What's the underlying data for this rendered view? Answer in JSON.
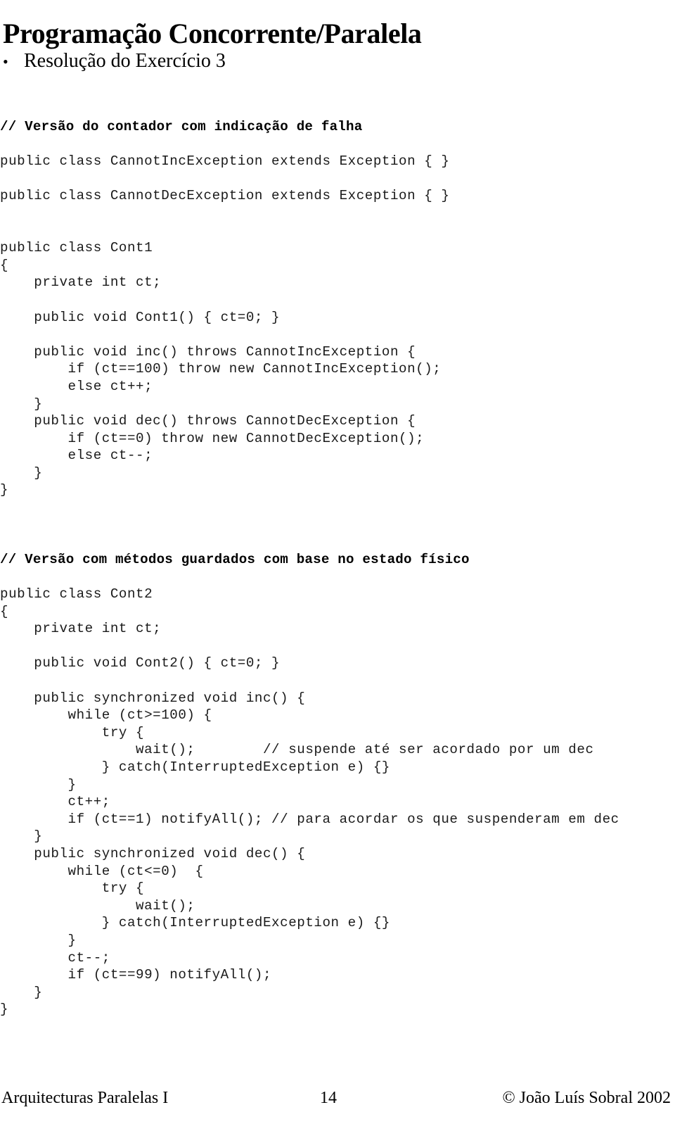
{
  "slide": {
    "title": "Programação Concorrente/Paralela",
    "bullet_marker": "•",
    "bullet_text": "Resolução do Exercício 3"
  },
  "code": {
    "lines": [
      {
        "text": "// Versão do contador com indicação de falha",
        "style": "comment-head"
      },
      {
        "text": "",
        "style": "blank"
      },
      {
        "text": "public class CannotIncException extends Exception { }",
        "style": "code"
      },
      {
        "text": "",
        "style": "blank"
      },
      {
        "text": "public class CannotDecException extends Exception { }",
        "style": "code"
      },
      {
        "text": "",
        "style": "blank"
      },
      {
        "text": "",
        "style": "blank"
      },
      {
        "text": "public class Cont1",
        "style": "code"
      },
      {
        "text": "{",
        "style": "code"
      },
      {
        "text": "    private int ct;",
        "style": "code"
      },
      {
        "text": "",
        "style": "blank"
      },
      {
        "text": "    public void Cont1() { ct=0; }",
        "style": "code"
      },
      {
        "text": "",
        "style": "blank"
      },
      {
        "text": "    public void inc() throws CannotIncException {",
        "style": "code"
      },
      {
        "text": "        if (ct==100) throw new CannotIncException();",
        "style": "code"
      },
      {
        "text": "        else ct++;",
        "style": "code"
      },
      {
        "text": "    }",
        "style": "code"
      },
      {
        "text": "    public void dec() throws CannotDecException {",
        "style": "code"
      },
      {
        "text": "        if (ct==0) throw new CannotDecException();",
        "style": "code"
      },
      {
        "text": "        else ct--;",
        "style": "code"
      },
      {
        "text": "    }",
        "style": "code"
      },
      {
        "text": "}",
        "style": "code"
      },
      {
        "text": "",
        "style": "blank"
      },
      {
        "text": "",
        "style": "blank"
      },
      {
        "text": "",
        "style": "blank"
      },
      {
        "text": "// Versão com métodos guardados com base no estado físico",
        "style": "comment-head"
      },
      {
        "text": "",
        "style": "blank"
      },
      {
        "text": "public class Cont2",
        "style": "code"
      },
      {
        "text": "{",
        "style": "code"
      },
      {
        "text": "    private int ct;",
        "style": "code"
      },
      {
        "text": "",
        "style": "blank"
      },
      {
        "text": "    public void Cont2() { ct=0; }",
        "style": "code"
      },
      {
        "text": "",
        "style": "blank"
      },
      {
        "text": "    public synchronized void inc() {",
        "style": "code"
      },
      {
        "text": "        while (ct>=100) {",
        "style": "code"
      },
      {
        "text": "            try {",
        "style": "code"
      },
      {
        "text": "                wait();        // suspende até ser acordado por um dec",
        "style": "code"
      },
      {
        "text": "            } catch(InterruptedException e) {}",
        "style": "code"
      },
      {
        "text": "        }",
        "style": "code"
      },
      {
        "text": "        ct++;",
        "style": "code"
      },
      {
        "text": "        if (ct==1) notifyAll(); // para acordar os que suspenderam em dec",
        "style": "code"
      },
      {
        "text": "    }",
        "style": "code"
      },
      {
        "text": "    public synchronized void dec() {",
        "style": "code"
      },
      {
        "text": "        while (ct<=0)  {",
        "style": "code"
      },
      {
        "text": "            try {",
        "style": "code"
      },
      {
        "text": "                wait();",
        "style": "code"
      },
      {
        "text": "            } catch(InterruptedException e) {}",
        "style": "code"
      },
      {
        "text": "        }",
        "style": "code"
      },
      {
        "text": "        ct--;",
        "style": "code"
      },
      {
        "text": "        if (ct==99) notifyAll();",
        "style": "code"
      },
      {
        "text": "    }",
        "style": "code"
      },
      {
        "text": "}",
        "style": "code"
      }
    ]
  },
  "footer": {
    "left": "Arquitecturas Paralelas I",
    "page_number": "14",
    "right": "© João Luís Sobral 2002"
  }
}
